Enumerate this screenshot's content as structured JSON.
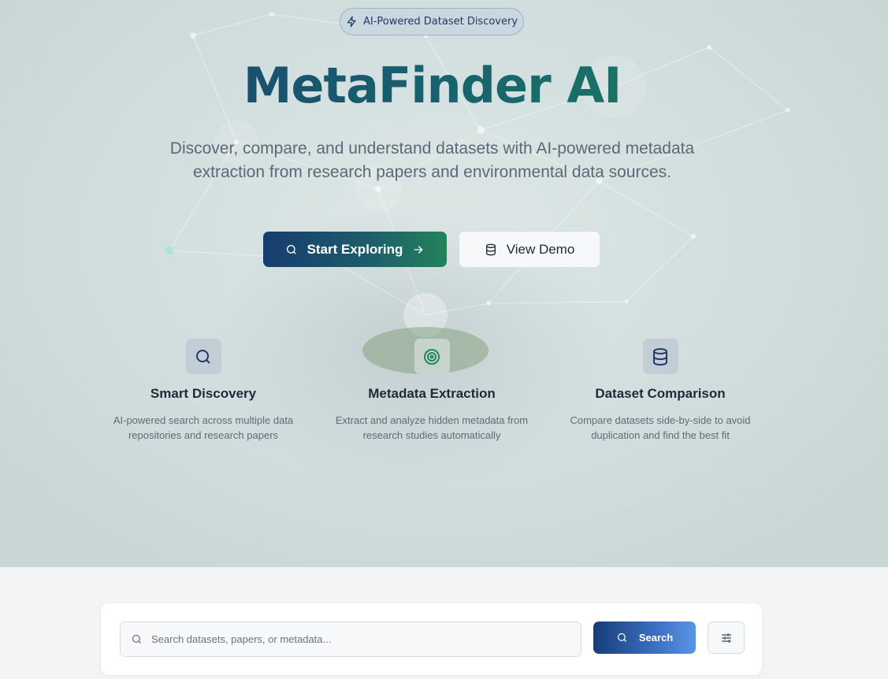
{
  "hero": {
    "badge": "AI-Powered Dataset Discovery",
    "title": "MetaFinder AI",
    "subtitle_line1": "Discover, compare, and understand datasets with AI-powered metadata",
    "subtitle_line2": "extraction from research papers and environmental data sources.",
    "primary_button": "Start Exploring",
    "secondary_button": "View Demo"
  },
  "features": [
    {
      "icon": "search-icon",
      "title": "Smart Discovery",
      "line1": "AI-powered search across multiple data",
      "line2": "repositories and research papers"
    },
    {
      "icon": "target-icon",
      "title": "Metadata Extraction",
      "line1": "Extract and analyze hidden metadata from",
      "line2": "research studies automatically"
    },
    {
      "icon": "database-icon",
      "title": "Dataset Comparison",
      "line1": "Compare datasets side-by-side to avoid",
      "line2": "duplication and find the best fit"
    }
  ],
  "search": {
    "placeholder": "Search datasets, papers, or metadata...",
    "button": "Search"
  },
  "colors": {
    "brand_navy": "#163d6e",
    "brand_green": "#23835c",
    "search_blue": "#3b6fc0"
  }
}
